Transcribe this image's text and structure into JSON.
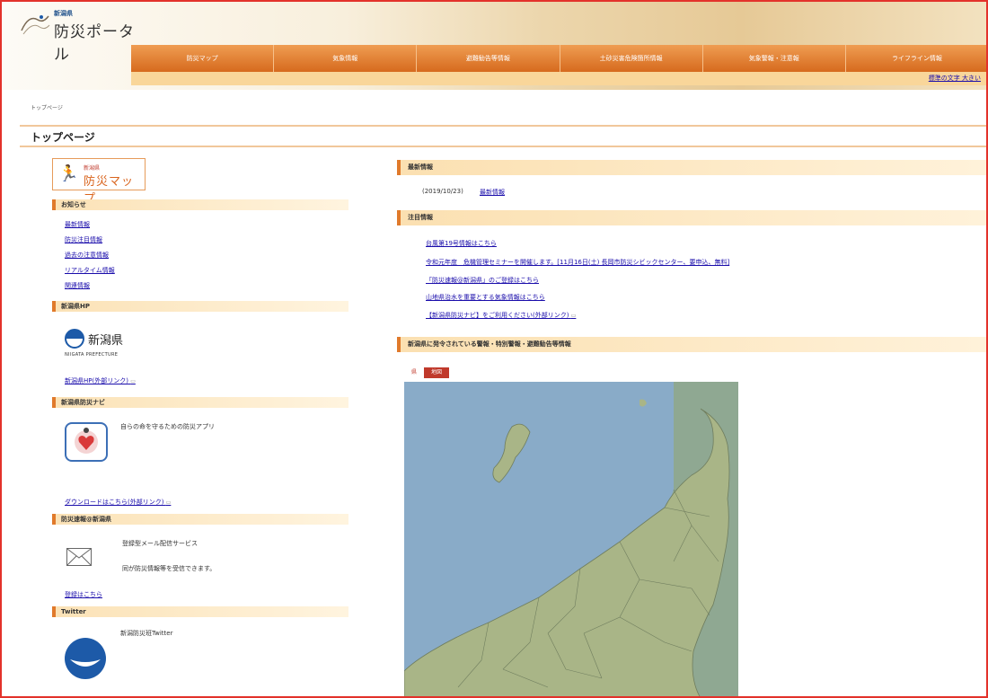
{
  "header": {
    "logo_sub": "新潟県",
    "logo_title": "防災ポータル",
    "nav": [
      "防災マップ",
      "気象情報",
      "避難勧告等情報",
      "土砂災害危険箇所情報",
      "気象警報・注意報",
      "ライフライン情報"
    ],
    "sub_links": "標準の文字 大きい"
  },
  "breadcrumb": "トップページ",
  "page_title": "トップページ",
  "left": {
    "map_badge": {
      "sub": "新潟県",
      "main": "防災マップ"
    },
    "notices": {
      "heading": "お知らせ",
      "links": [
        "最新情報",
        "防災注目情報",
        "過去の注意情報",
        "リアルタイム情報",
        "関連情報"
      ]
    },
    "pref_hp": {
      "heading": "新潟県HP",
      "logo_name": "新潟県",
      "logo_en": "NIIGATA PREFECTURE",
      "link": "新潟県HP(外部リンク)"
    },
    "navi": {
      "heading": "新潟県防災ナビ",
      "desc": "自らの命を守るための防災アプリ",
      "link": "ダウンロードはこちら(外部リンク)"
    },
    "mail": {
      "heading": "防災速報@新潟県",
      "desc1": "登録型メール配信サービス",
      "desc2": "同が防災情報等を受信できます。",
      "link": "登録はこちら"
    },
    "twitter": {
      "heading": "Twitter",
      "label": "新潟防災班Twitter"
    },
    "external_mark": "▭"
  },
  "right": {
    "latest": {
      "heading": "最新情報",
      "date": "(2019/10/23)",
      "link": "最新情報"
    },
    "attention": {
      "heading": "注目情報",
      "links": [
        "台風第19号情報はこちら",
        "令和元年度　危機管理セミナーを開催します。[11月16日(土) 長岡市防災シビックセンター、要申込、無料]",
        "「防災速報@新潟県」のご登録はこちら",
        "山地県治水を重要とする気象情報はこちら",
        "【新潟県防災ナビ】をご利用ください(外部リンク)"
      ]
    },
    "warnings": {
      "heading": "新潟県に発令されている警報・特別警報・避難勧告等情報",
      "tabs": [
        "県",
        "地図"
      ]
    }
  }
}
